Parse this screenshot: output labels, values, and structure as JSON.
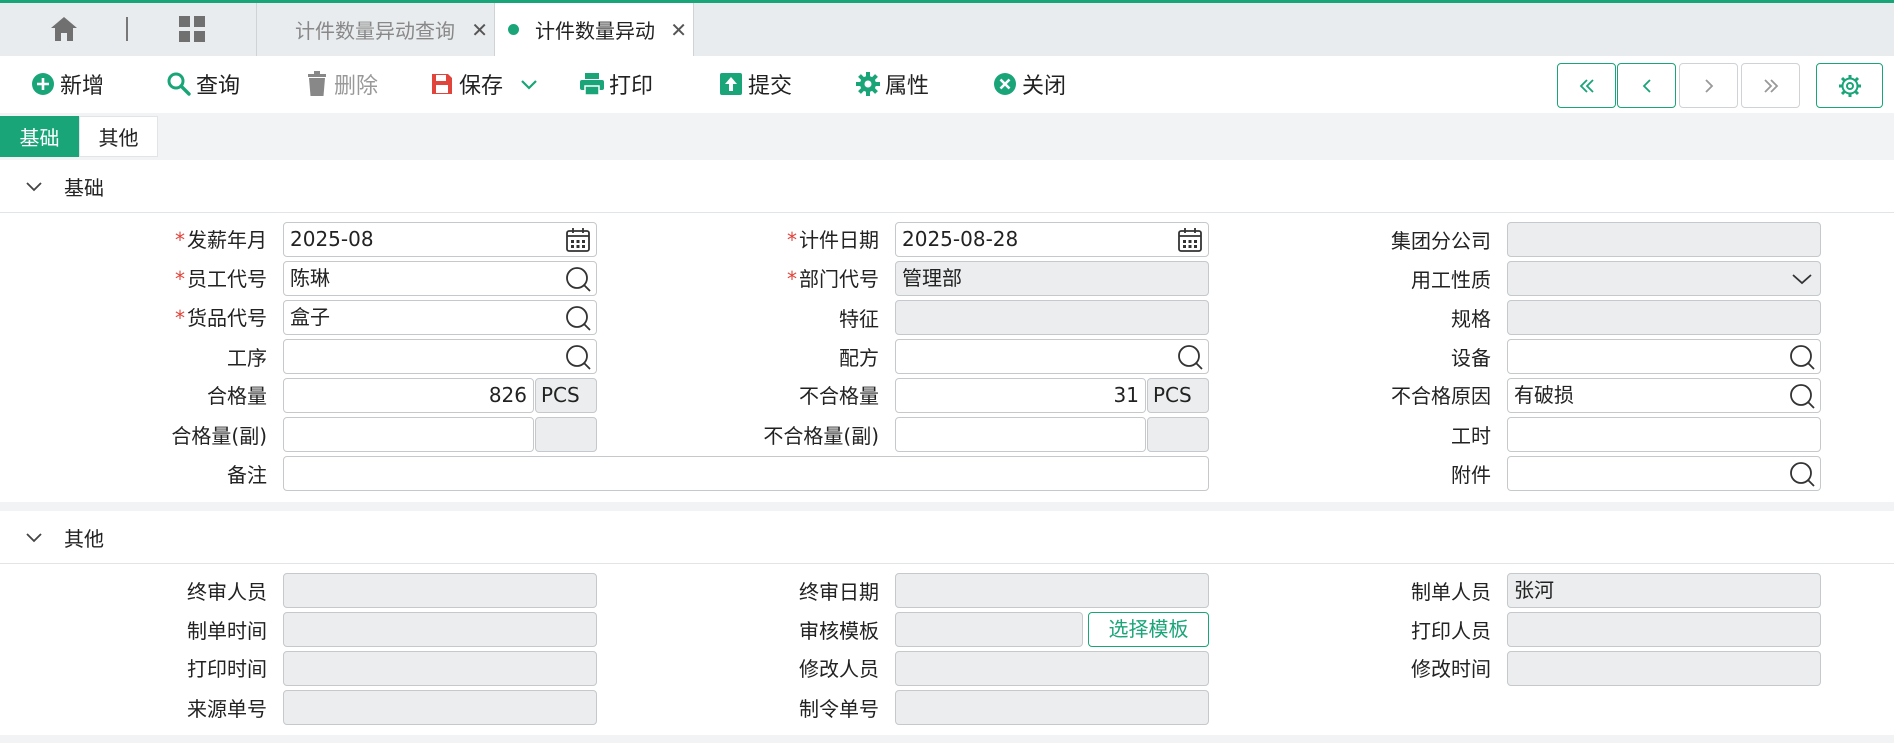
{
  "tabs": {
    "items": [
      {
        "label": "计件数量异动查询",
        "active": false
      },
      {
        "label": "计件数量异动",
        "active": true
      }
    ]
  },
  "toolbar": {
    "add": "新增",
    "query": "查询",
    "delete": "删除",
    "save": "保存",
    "print": "打印",
    "submit": "提交",
    "properties": "属性",
    "close": "关闭"
  },
  "subtabs": [
    "基础",
    "其他"
  ],
  "basic": {
    "title": "基础",
    "pay_month_label": "发薪年月",
    "pay_month": "2025-08",
    "piece_date_label": "计件日期",
    "piece_date": "2025-08-28",
    "group_company_label": "集团分公司",
    "group_company": "",
    "employee_label": "员工代号",
    "employee": "陈琳",
    "dept_label": "部门代号",
    "dept": "管理部",
    "employment_type_label": "用工性质",
    "employment_type": "",
    "goods_label": "货品代号",
    "goods": "盒子",
    "feature_label": "特征",
    "feature": "",
    "spec_label": "规格",
    "spec": "",
    "process_label": "工序",
    "process": "",
    "formula_label": "配方",
    "formula": "",
    "equipment_label": "设备",
    "equipment": "",
    "qualified_label": "合格量",
    "qualified": "826",
    "qualified_unit": "PCS",
    "unqualified_label": "不合格量",
    "unqualified": "31",
    "unqualified_unit": "PCS",
    "unqualified_reason_label": "不合格原因",
    "unqualified_reason": "有破损",
    "qualified_sub_label": "合格量(副)",
    "qualified_sub": "",
    "unqualified_sub_label": "不合格量(副)",
    "unqualified_sub": "",
    "work_hours_label": "工时",
    "work_hours": "",
    "remark_label": "备注",
    "remark": "",
    "attachment_label": "附件",
    "attachment": ""
  },
  "other": {
    "title": "其他",
    "final_reviewer_label": "终审人员",
    "final_reviewer": "",
    "final_review_date_label": "终审日期",
    "final_review_date": "",
    "creator_label": "制单人员",
    "creator": "张河",
    "create_time_label": "制单时间",
    "create_time": "",
    "review_template_label": "审核模板",
    "review_template": "",
    "select_template": "选择模板",
    "printer_label": "打印人员",
    "printer": "",
    "print_time_label": "打印时间",
    "print_time": "",
    "modifier_label": "修改人员",
    "modifier": "",
    "modify_time_label": "修改时间",
    "modify_time": "",
    "source_no_label": "来源单号",
    "source_no": "",
    "order_no_label": "制令单号",
    "order_no": ""
  },
  "colors": {
    "accent": "#1aa579",
    "required": "#e0443a"
  }
}
